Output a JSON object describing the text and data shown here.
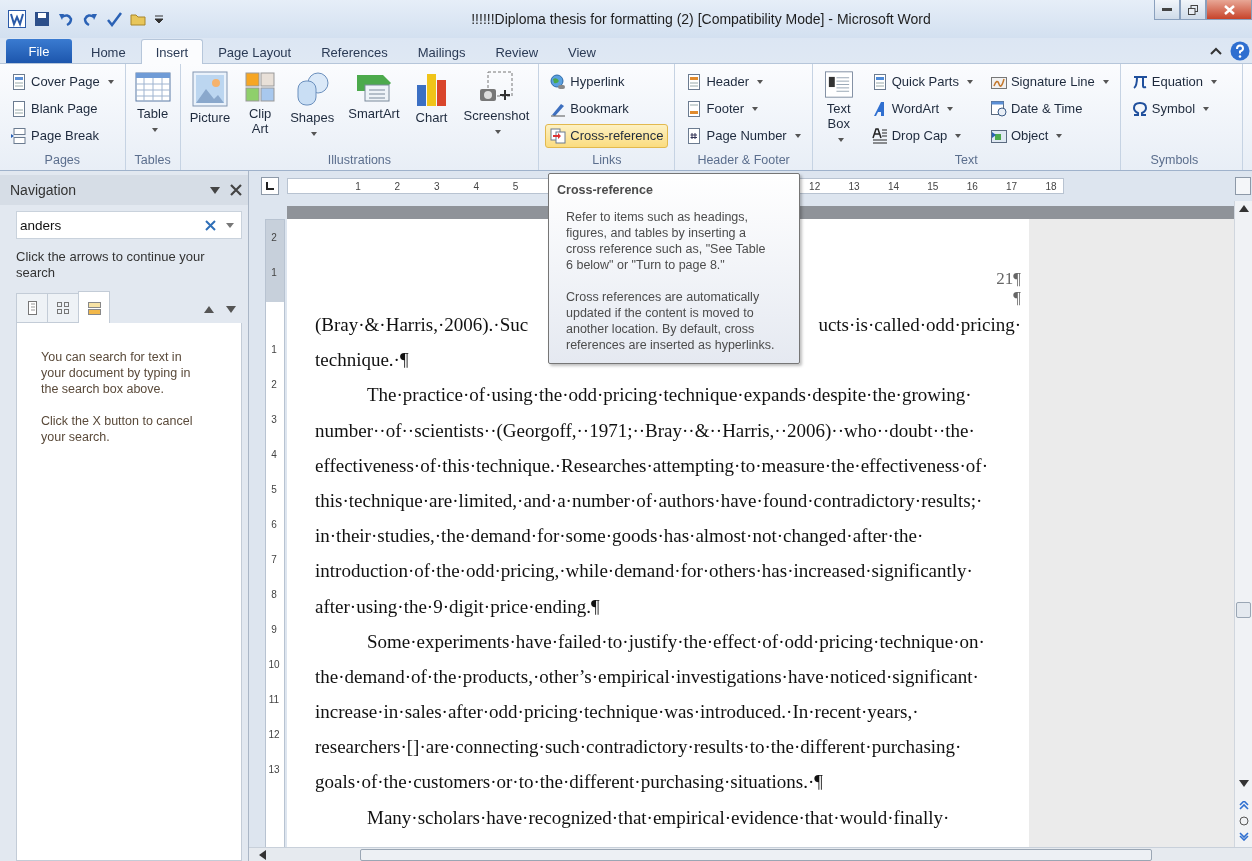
{
  "window": {
    "title": "!!!!!!Diploma thesis for formatting (2) [Compatibility Mode]  -  Microsoft Word"
  },
  "tabs": [
    {
      "label": "File",
      "kind": "file",
      "selected": false
    },
    {
      "label": "Home",
      "kind": "tab",
      "selected": false
    },
    {
      "label": "Insert",
      "kind": "tab",
      "selected": true
    },
    {
      "label": "Page Layout",
      "kind": "tab",
      "selected": false
    },
    {
      "label": "References",
      "kind": "tab",
      "selected": false
    },
    {
      "label": "Mailings",
      "kind": "tab",
      "selected": false
    },
    {
      "label": "Review",
      "kind": "tab",
      "selected": false
    },
    {
      "label": "View",
      "kind": "tab",
      "selected": false
    }
  ],
  "ribbon": {
    "groups": [
      {
        "label": "Pages",
        "items": [
          {
            "label": "Cover Page",
            "kind": "small",
            "dropdown": true,
            "highlighted": false
          },
          {
            "label": "Blank Page",
            "kind": "small",
            "dropdown": false,
            "highlighted": false
          },
          {
            "label": "Page Break",
            "kind": "small",
            "dropdown": false,
            "highlighted": false
          }
        ]
      },
      {
        "label": "Tables",
        "items": [
          {
            "label": "Table",
            "kind": "large",
            "dropdown": true,
            "highlighted": false
          }
        ]
      },
      {
        "label": "Illustrations",
        "items": [
          {
            "label": "Picture",
            "kind": "large",
            "dropdown": false,
            "highlighted": false
          },
          {
            "label": "Clip Art",
            "kind": "large",
            "dropdown": false,
            "highlighted": false
          },
          {
            "label": "Shapes",
            "kind": "large",
            "dropdown": true,
            "highlighted": false
          },
          {
            "label": "SmartArt",
            "kind": "large",
            "dropdown": false,
            "highlighted": false
          },
          {
            "label": "Chart",
            "kind": "large",
            "dropdown": false,
            "highlighted": false
          },
          {
            "label": "Screenshot",
            "kind": "large",
            "dropdown": true,
            "highlighted": false
          }
        ]
      },
      {
        "label": "Links",
        "items": [
          {
            "label": "Hyperlink",
            "kind": "small",
            "dropdown": false,
            "highlighted": false
          },
          {
            "label": "Bookmark",
            "kind": "small",
            "dropdown": false,
            "highlighted": false
          },
          {
            "label": "Cross-reference",
            "kind": "small",
            "dropdown": false,
            "highlighted": true
          }
        ]
      },
      {
        "label": "Header & Footer",
        "items": [
          {
            "label": "Header",
            "kind": "small",
            "dropdown": true,
            "highlighted": false
          },
          {
            "label": "Footer",
            "kind": "small",
            "dropdown": true,
            "highlighted": false
          },
          {
            "label": "Page Number",
            "kind": "small",
            "dropdown": true,
            "highlighted": false
          }
        ]
      },
      {
        "label": "Text",
        "items": [
          {
            "label": "Text Box",
            "kind": "large",
            "dropdown": true,
            "highlighted": false
          },
          {
            "label": "Quick Parts",
            "kind": "small",
            "dropdown": true,
            "highlighted": false
          },
          {
            "label": "WordArt",
            "kind": "small",
            "dropdown": true,
            "highlighted": false
          },
          {
            "label": "Drop Cap",
            "kind": "small",
            "dropdown": true,
            "highlighted": false
          },
          {
            "label": "Signature Line",
            "kind": "small",
            "dropdown": true,
            "highlighted": false
          },
          {
            "label": "Date & Time",
            "kind": "small",
            "dropdown": false,
            "highlighted": false
          },
          {
            "label": "Object",
            "kind": "small",
            "dropdown": true,
            "highlighted": false
          }
        ]
      },
      {
        "label": "Symbols",
        "items": [
          {
            "label": "Equation",
            "kind": "small",
            "dropdown": true,
            "highlighted": false
          },
          {
            "label": "Symbol",
            "kind": "small",
            "dropdown": true,
            "highlighted": false
          }
        ]
      }
    ]
  },
  "navigation": {
    "title": "Navigation",
    "search": {
      "value": "anders"
    },
    "hint": "Click the arrows to continue your search",
    "tabs": [
      {
        "selected": false
      },
      {
        "selected": false
      },
      {
        "selected": true
      }
    ],
    "messages": [
      "You can search for text in your document by typing in the search box above.",
      "Click the X button to cancel your search."
    ]
  },
  "ruler": {
    "left_numbers": [
      "1",
      "2",
      "3",
      "4",
      "5"
    ],
    "right_numbers": [
      "12",
      "13",
      "14",
      "15",
      "16",
      "17",
      "18"
    ],
    "vertical_margin_numbers": [
      "2",
      "1"
    ],
    "vertical_numbers": [
      "1",
      "2",
      "3",
      "4",
      "5",
      "6",
      "7",
      "8",
      "9",
      "10",
      "11",
      "12",
      "13"
    ]
  },
  "tooltip": {
    "title": "Cross-reference",
    "paragraphs": [
      "Refer to items such as headings, figures, and tables by inserting a cross reference such as, \"See Table 6 below\" or \"Turn to page 8.\"",
      "Cross references are automatically updated if the content is moved to another location. By default, cross references are inserted as hyperlinks."
    ]
  },
  "document": {
    "page_marks": [
      "21¶",
      "¶"
    ],
    "paragraphs": [
      {
        "lines": [
          [
            "(Bray·&·Harris,·2006).·Suc",
            "ucts·is·called·odd·pricing·"
          ],
          "technique.·¶"
        ]
      },
      {
        "lines": [
          "The·practice·of·using·the·odd·pricing·technique·expands·despite·the·growing·",
          "number··of··scientists··(Georgoff,··1971;··Bray··&··Harris,··2006)··who··doubt··the·",
          "effectiveness·of·this·technique.·Researches·attempting·to·measure·the·effectiveness·of·",
          "this·technique·are·limited,·and·a·number·of·authors·have·found·contradictory·results;·",
          "in·their·studies,·the·demand·for·some·goods·has·almost·not·changed·after·the·",
          "introduction·of·the·odd·pricing,·while·demand·for·others·has·increased·significantly·",
          "after·using·the·9·digit·price·ending.¶"
        ]
      },
      {
        "lines": [
          "Some·experiments·have·failed·to·justify·the·effect·of·odd·pricing·technique·on·",
          "the·demand·of·the·products,·other’s·empirical·investigations·have·noticed·significant·",
          "increase·in·sales·after·odd·pricing·technique·was·introduced.·In·recent·years,·",
          "researchers·[]·are·connecting·such·contradictory·results·to·the·different·purchasing·",
          "goals·of·the·customers·or·to·the·different·purchasing·situations.·¶"
        ]
      },
      {
        "lines": [
          "Many·scholars·have·recognized·that·empirical·evidence·that·would·finally·"
        ]
      }
    ]
  }
}
